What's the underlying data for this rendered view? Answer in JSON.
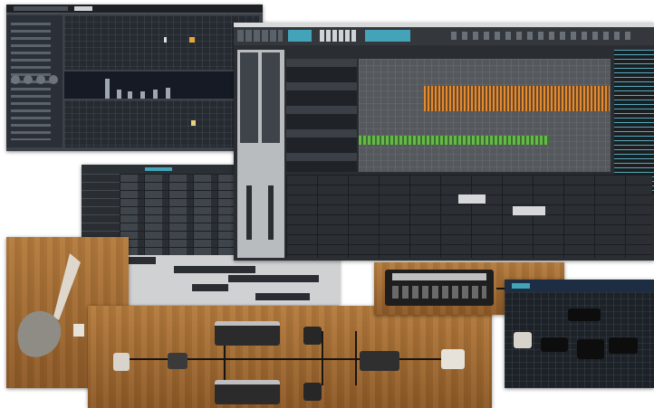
{
  "screens": [
    {
      "id": "step-sequencer",
      "kind": "step-sequencer"
    },
    {
      "id": "main-daw",
      "kind": "arrange-window"
    },
    {
      "id": "pattern-editor",
      "kind": "clip-grid"
    },
    {
      "id": "guitar-rig",
      "kind": "amp-sim"
    },
    {
      "id": "amp-head",
      "kind": "amp"
    },
    {
      "id": "rack-window",
      "kind": "rack"
    }
  ],
  "colors": {
    "seq_bg": "#3a3f47",
    "seq_row": "#242930",
    "seq_accent": "#e7a53b",
    "daw_bg": "#2a2d31",
    "daw_wave_orange": "#e48a2f",
    "daw_wave_green": "#65b94a",
    "toolbar_teal": "#43a3b8",
    "wood": "#9e6730"
  },
  "icons": [
    "guitar-icon",
    "pedal-icon",
    "amp-icon",
    "cable-icon",
    "footswitch-icon"
  ]
}
